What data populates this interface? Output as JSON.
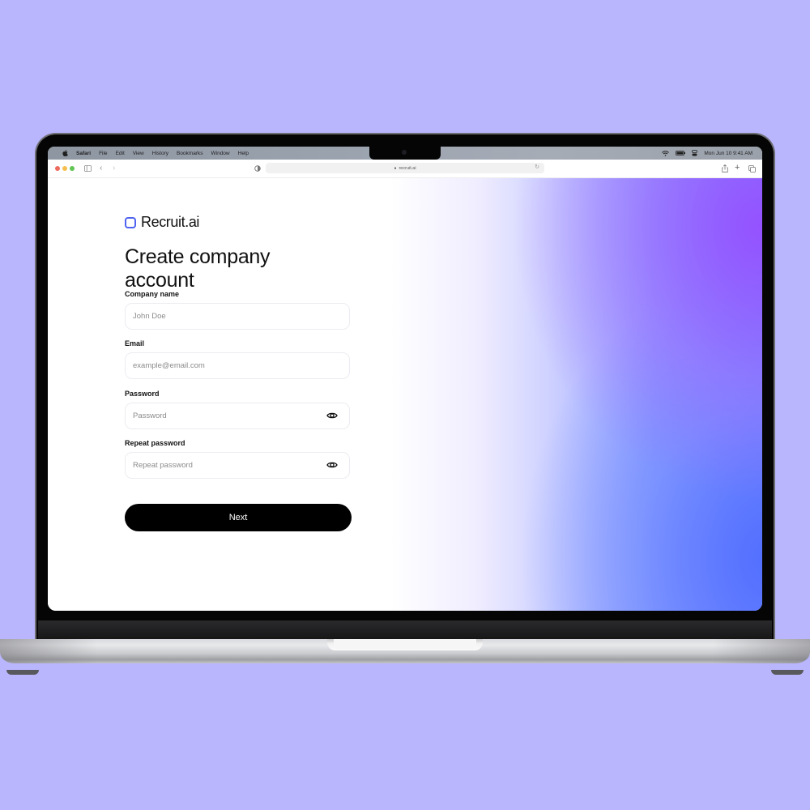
{
  "menubar": {
    "app": "Safari",
    "items": [
      "File",
      "Edit",
      "View",
      "History",
      "Bookmarks",
      "Window",
      "Help"
    ],
    "datetime": "Mon Jun 10  9:41 AM"
  },
  "browser": {
    "url": "recruit.ai"
  },
  "page": {
    "brand": "Recruit.ai",
    "title": "Create company account",
    "fields": [
      {
        "label": "Company name",
        "placeholder": "John Doe",
        "value": ""
      },
      {
        "label": "Email",
        "placeholder": "example@email.com",
        "value": ""
      },
      {
        "label": "Password",
        "placeholder": "Password",
        "value": ""
      },
      {
        "label": "Repeat password",
        "placeholder": "Repeat password",
        "value": ""
      }
    ],
    "submit_label": "Next"
  },
  "colors": {
    "brand_accent": "#4f63f0",
    "button_bg": "#000000",
    "background": "#b9b6fe"
  }
}
